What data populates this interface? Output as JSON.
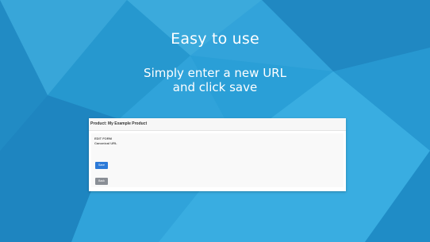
{
  "headline": {
    "title": "Easy to use",
    "line1": "Simply enter a new URL",
    "line2": "and click save"
  },
  "panel": {
    "header": "Product: My Example Product",
    "section_label": "EDIT FORM",
    "field_label": "Canonical URL",
    "save_label": "Save",
    "back_label": "Back"
  },
  "colors": {
    "background": "#2a9fd6",
    "save_button": "#2d7ad8",
    "back_button": "#8a8f96"
  }
}
